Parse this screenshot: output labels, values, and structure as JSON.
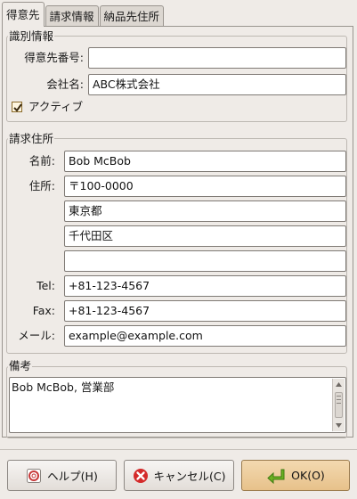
{
  "tabs": {
    "customer": "得意先",
    "billing": "請求情報",
    "delivery": "納品先住所"
  },
  "identity": {
    "legend": "識別情報",
    "code_label": "得意先番号:",
    "code_value": "",
    "company_label": "会社名:",
    "company_value": "ABC株式会社",
    "active_label": "アクティブ"
  },
  "address": {
    "legend": "請求住所",
    "name_label": "名前:",
    "name_value": "Bob McBob",
    "address_label": "住所:",
    "line1": "〒100-0000",
    "line2": "東京都",
    "line3": "千代田区",
    "line4": "",
    "tel_label": "Tel:",
    "tel_value": "+81-123-4567",
    "fax_label": "Fax:",
    "fax_value": "+81-123-4567",
    "mail_label": "メール:",
    "mail_value": "example@example.com"
  },
  "notes": {
    "legend": "備考",
    "text": "Bob McBob, 営業部"
  },
  "buttons": {
    "help": "ヘルプ(H)",
    "cancel": "キャンセル(C)",
    "ok": "OK(O)"
  },
  "colors": {
    "ok_button": "#e7c18a",
    "cancel_icon": "#d42a2a",
    "ok_icon": "#6ab022"
  }
}
